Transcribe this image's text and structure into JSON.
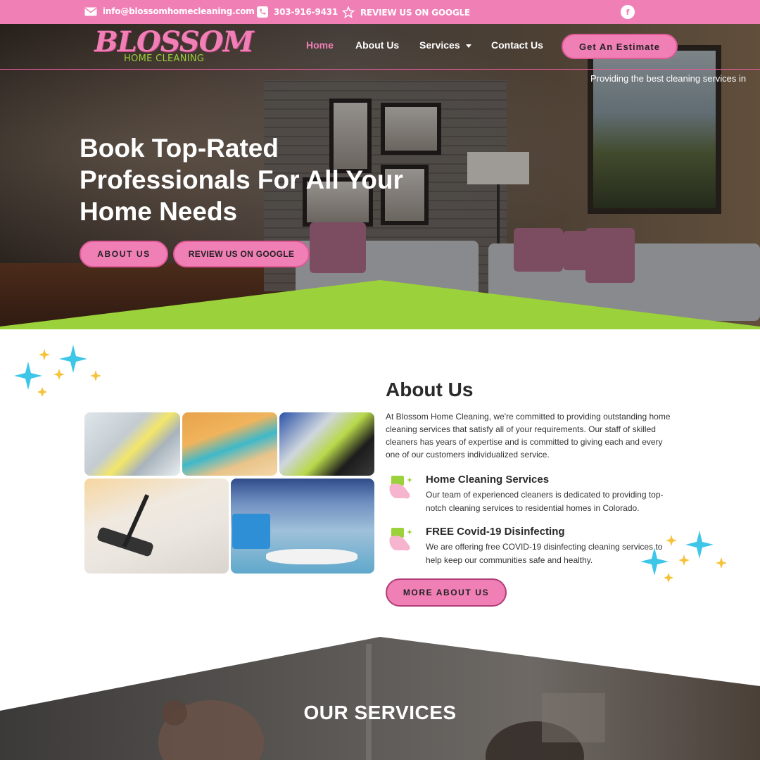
{
  "topbar": {
    "email": "info@blossomhomecleaning.com",
    "phone": "303-916-9431",
    "review": "REVIEW US ON GOOGLE",
    "social_icon": "facebook-icon",
    "social_glyph": "f"
  },
  "header": {
    "logo_main": "BLOSSOM",
    "logo_sub": "HOME CLEANING",
    "nav": [
      "Home",
      "About Us",
      "Services",
      "Contact Us"
    ],
    "cta": "Get An Estimate",
    "tagline": "Providing the best cleaning services in"
  },
  "hero": {
    "headline_lines": [
      "Book Top-Rated",
      "Professionals For All Your",
      "Home Needs"
    ],
    "btn_about": "ABOUT US",
    "btn_review": "REVIEW US ON GOOGLE"
  },
  "about": {
    "title": "About Us",
    "text": "At Blossom Home Cleaning, we're committed to providing outstanding home cleaning services that satisfy all of your requirements. Our staff of skilled cleaners has years of expertise and is committed to giving each and every one of our customers individualized service.",
    "features": [
      {
        "title": "Home Cleaning Services",
        "text": "Our team of experienced cleaners is dedicated to providing top-notch cleaning services to residential homes in Colorado."
      },
      {
        "title": "FREE Covid-19 Disinfecting",
        "text": "We are offering free COVID-19 disinfecting cleaning services to help keep our communities safe and healthy."
      }
    ],
    "button": "MORE ABOUT US"
  },
  "services": {
    "title": "OUR SERVICES"
  },
  "colors": {
    "pink": "#f07fb6",
    "green": "#9bd13a",
    "sparkle_blue": "#3ec6e8",
    "sparkle_yellow": "#f5c23a"
  }
}
